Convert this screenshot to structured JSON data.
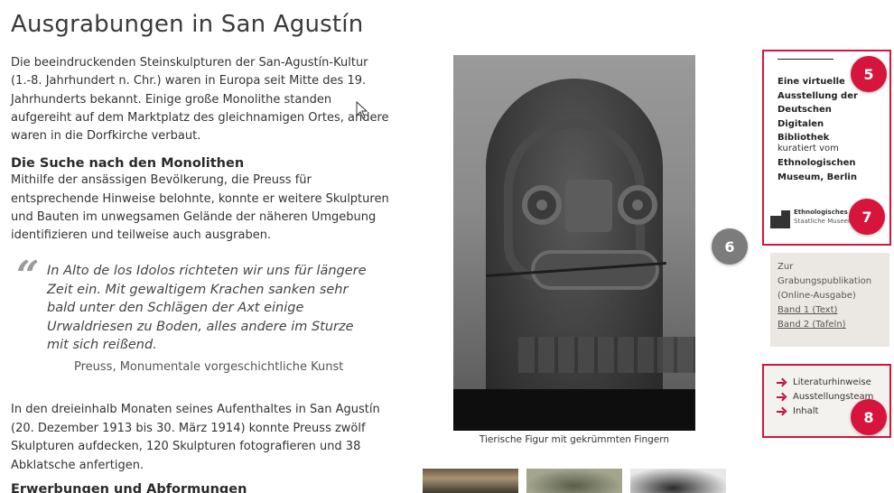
{
  "page": {
    "title": "Ausgrabungen in San Agustín",
    "intro": "Die beeindruckenden Steinskulpturen der San-Agustín-Kultur (1.-8. Jahrhundert n. Chr.) waren in Europa seit Mitte des 19. Jahrhunderts bekannt. Einige große Monolithe standen aufgereiht auf dem Marktplatz des gleichnamigen Ortes, andere waren in die Dorfkirche verbaut.",
    "section1_heading": "Die Suche nach den Monolithen",
    "section1_text": "Mithilfe der ansässigen Bevölkerung, die Preuss für entsprechende Hinweise belohnte, konnte er weitere Skulpturen und Bauten im unwegsamen Gelände der näheren Umgebung identifizieren und teilweise auch ausgraben.",
    "quote_mark": "“",
    "quote_text": "In Alto de los Idolos richteten wir uns für längere Zeit ein. Mit gewaltigem Krachen sanken sehr bald unter den Schlägen der Axt einige Urwaldriesen zu Boden, alles andere im Sturze mit sich reißend.",
    "quote_source": "Preuss, Monumentale vorgeschichtliche Kunst",
    "section2_text": "In den dreieinhalb Monaten seines Aufenthaltes in San Agustín (20. Dezember 1913 bis 30. März 1914) konnte Preuss zwölf Skulpturen aufdecken, 120 Skulpturen fotografieren und 38 Abklatsche anfertigen.",
    "section3_heading": "Erwerbungen und Abformungen"
  },
  "figure": {
    "caption": "Tierische Figur mit gekrümmten Fingern"
  },
  "sidebar": {
    "exhibition_text": "Eine virtuelle Ausstellung der Deutschen Digitalen Bibliothek",
    "curated_label": "kuratiert vom",
    "museum_name": "Ethnologischen Museum, Berlin",
    "logo_line1": "Ethnologisches Museum",
    "logo_line2": "Staatliche Museen zu Berlin",
    "publication_intro": "Zur Grabungspublikation (Online-Ausgabe)",
    "links": [
      "Band 1 (Text)",
      "Band 2 (Tafeln)"
    ],
    "nav_items": [
      "Literaturhinweise",
      "Ausstellungsteam",
      "Inhalt"
    ]
  },
  "annotations": {
    "badge5": "5",
    "badge6": "6",
    "badge7": "7",
    "badge8": "8"
  },
  "colors": {
    "accent": "#d6143c",
    "badge_grey": "#7c7c7c",
    "panel_bg": "#ebe8e4"
  }
}
